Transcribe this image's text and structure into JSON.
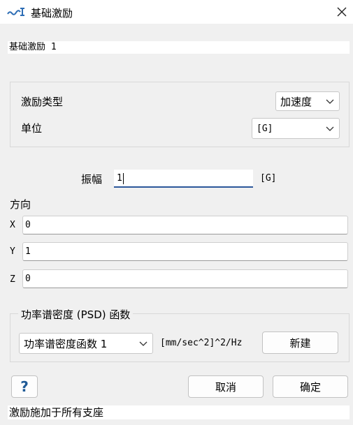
{
  "window": {
    "title": "基础激励",
    "app_icon": "ansys-wave-icon",
    "close_glyph": "✕"
  },
  "name_field": {
    "value": "基础激励 1"
  },
  "excitation": {
    "type_label": "激励类型",
    "type_value": "加速度",
    "unit_label": "单位",
    "unit_value": "[G]"
  },
  "amplitude": {
    "label": "振幅",
    "value": "1",
    "unit": "[G]"
  },
  "direction": {
    "label": "方向",
    "axes": [
      {
        "label": "X",
        "value": "0"
      },
      {
        "label": "Y",
        "value": "1"
      },
      {
        "label": "Z",
        "value": "0"
      }
    ]
  },
  "psd": {
    "group_label": "功率谱密度 (PSD) 函数",
    "function_value": "功率谱密度函数 1",
    "unit": "[mm/sec^2]^2/Hz",
    "new_button": "新建"
  },
  "buttons": {
    "help_glyph": "?",
    "cancel": "取消",
    "ok": "确定"
  },
  "status": {
    "text": "激励施加于所有支座"
  },
  "colors": {
    "accent_underline": "#2b579a",
    "help_icon": "#1f5a96",
    "window_bg": "#f0f0f0"
  }
}
